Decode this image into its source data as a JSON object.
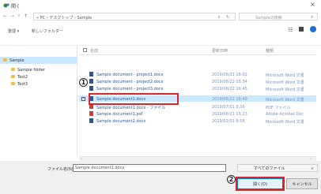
{
  "window": {
    "title": "開く",
    "close": "×"
  },
  "nav": {
    "path": "« PC › デスクトップ › Sample",
    "search_placeholder": "Sampleの検索"
  },
  "toolbar": {
    "organize": "整理 ▾",
    "new_folder": "新しいフォルダー"
  },
  "sidebar": {
    "items": [
      {
        "label": "Sample",
        "selected": true
      },
      {
        "label": "Sample folder",
        "selected": false
      },
      {
        "label": "Test2",
        "selected": false
      },
      {
        "label": "Test3",
        "selected": false
      }
    ]
  },
  "columns": {
    "name": "名前",
    "date": "更新日時",
    "type": "種類"
  },
  "files": [
    {
      "name": "Sample document - project1.docx",
      "date": "2019/06/21 16:02",
      "type": "Microsoft Word 文書",
      "icon": "word-icon"
    },
    {
      "name": "Sample document - project2.docx",
      "date": "2019/06/22 16:34",
      "type": "Microsoft Word 文書",
      "icon": "word-icon"
    },
    {
      "name": "Sample document - project3.docx",
      "date": "2019/06/22 16:45",
      "type": "Microsoft Word 文書",
      "icon": "word-icon"
    },
    {
      "name": "Sample document1.docx",
      "date": "2019/06/22 16:49",
      "type": "Microsoft Word 文書",
      "icon": "word-icon",
      "selected": true
    },
    {
      "name": "Sample document1.docx - ファイル",
      "date": "2019/07/01 8:56",
      "type": "PDF ファイル",
      "icon": "pdf-icon"
    },
    {
      "name": "Sample document1.pdf",
      "date": "2019/06/21 15:23",
      "type": "Adobe Acrobat Doc",
      "icon": "pdf-icon"
    },
    {
      "name": "Sample document2.docx",
      "date": "2019/02/01 8:58",
      "type": "Microsoft Word 文書",
      "icon": "word-icon"
    }
  ],
  "bottom": {
    "filename_label": "ファイル名(N):",
    "filename_value": "Sample document1.docx",
    "filetype": "すべてのファイル",
    "open_button": "開く(O)",
    "cancel_button": "キャンセル"
  },
  "annotations": {
    "marker1": "1",
    "marker2": "2"
  },
  "colors": {
    "annotation_red": "#d9262b",
    "selection": "#cce8ff",
    "word": "#2b5797",
    "pdf": "#d23c2f"
  }
}
